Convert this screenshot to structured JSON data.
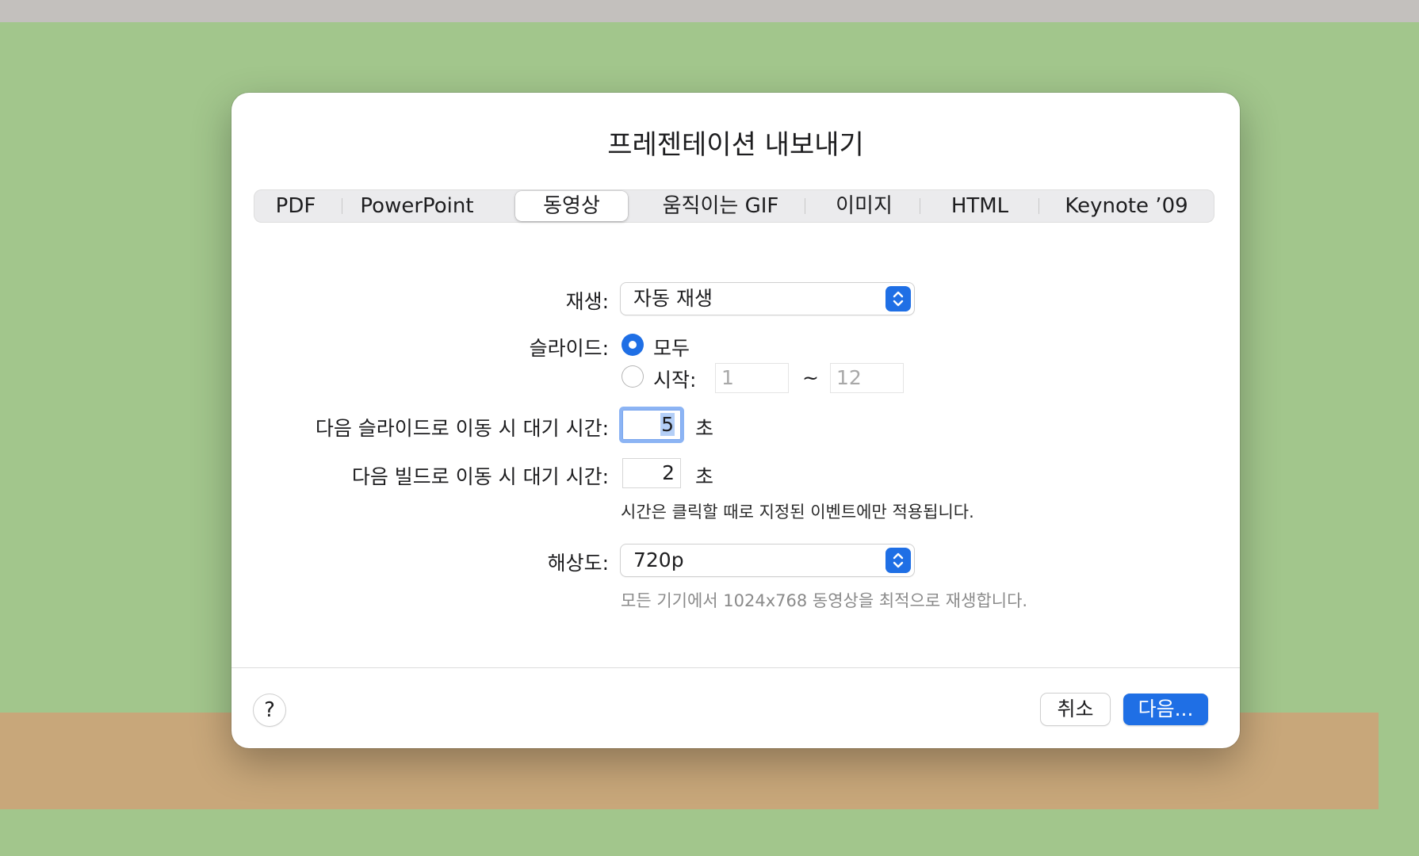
{
  "dialog": {
    "title": "프레젠테이션 내보내기",
    "tabs": [
      {
        "label": "PDF",
        "active": false
      },
      {
        "label": "PowerPoint",
        "active": false
      },
      {
        "label": "동영상",
        "active": true
      },
      {
        "label": "움직이는 GIF",
        "active": false
      },
      {
        "label": "이미지",
        "active": false
      },
      {
        "label": "HTML",
        "active": false
      },
      {
        "label": "Keynote ’09",
        "active": false
      }
    ]
  },
  "form": {
    "playback": {
      "label": "재생:",
      "value": "자동 재생"
    },
    "slides": {
      "label": "슬라이드:",
      "option_all": "모두",
      "option_from": "시작:",
      "selected": "all",
      "from_value": "1",
      "range_separator": "~",
      "to_value": "12"
    },
    "slide_delay": {
      "label": "다음 슬라이드로 이동 시 대기 시간:",
      "value": "5",
      "unit": "초"
    },
    "build_delay": {
      "label": "다음 빌드로 이동 시 대기 시간:",
      "value": "2",
      "unit": "초"
    },
    "timing_note": "시간은 클릭할 때로 지정된 이벤트에만 적용됩니다.",
    "resolution": {
      "label": "해상도:",
      "value": "720p",
      "note": "모든 기기에서 1024x768 동영상을 최적으로 재생합니다."
    }
  },
  "footer": {
    "help_label": "?",
    "cancel_label": "취소",
    "next_label": "다음..."
  },
  "colors": {
    "accent": "#1f6fe5",
    "background": "#a2c68c",
    "dialog": "#ffffff"
  }
}
